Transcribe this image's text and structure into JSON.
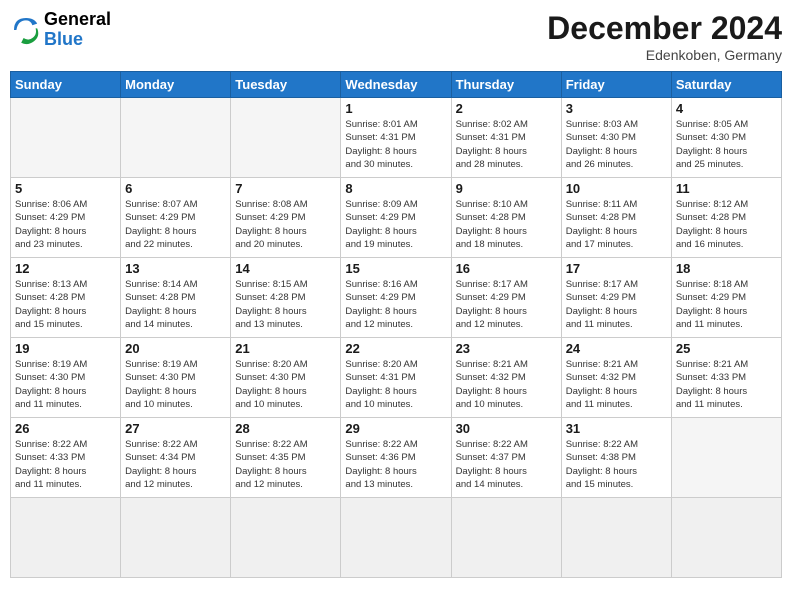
{
  "header": {
    "logo_line1": "General",
    "logo_line2": "Blue",
    "month_title": "December 2024",
    "location": "Edenkoben, Germany"
  },
  "weekdays": [
    "Sunday",
    "Monday",
    "Tuesday",
    "Wednesday",
    "Thursday",
    "Friday",
    "Saturday"
  ],
  "days": [
    {
      "num": "",
      "info": ""
    },
    {
      "num": "",
      "info": ""
    },
    {
      "num": "",
      "info": ""
    },
    {
      "num": "1",
      "info": "Sunrise: 8:01 AM\nSunset: 4:31 PM\nDaylight: 8 hours\nand 30 minutes."
    },
    {
      "num": "2",
      "info": "Sunrise: 8:02 AM\nSunset: 4:31 PM\nDaylight: 8 hours\nand 28 minutes."
    },
    {
      "num": "3",
      "info": "Sunrise: 8:03 AM\nSunset: 4:30 PM\nDaylight: 8 hours\nand 26 minutes."
    },
    {
      "num": "4",
      "info": "Sunrise: 8:05 AM\nSunset: 4:30 PM\nDaylight: 8 hours\nand 25 minutes."
    },
    {
      "num": "5",
      "info": "Sunrise: 8:06 AM\nSunset: 4:29 PM\nDaylight: 8 hours\nand 23 minutes."
    },
    {
      "num": "6",
      "info": "Sunrise: 8:07 AM\nSunset: 4:29 PM\nDaylight: 8 hours\nand 22 minutes."
    },
    {
      "num": "7",
      "info": "Sunrise: 8:08 AM\nSunset: 4:29 PM\nDaylight: 8 hours\nand 20 minutes."
    },
    {
      "num": "8",
      "info": "Sunrise: 8:09 AM\nSunset: 4:29 PM\nDaylight: 8 hours\nand 19 minutes."
    },
    {
      "num": "9",
      "info": "Sunrise: 8:10 AM\nSunset: 4:28 PM\nDaylight: 8 hours\nand 18 minutes."
    },
    {
      "num": "10",
      "info": "Sunrise: 8:11 AM\nSunset: 4:28 PM\nDaylight: 8 hours\nand 17 minutes."
    },
    {
      "num": "11",
      "info": "Sunrise: 8:12 AM\nSunset: 4:28 PM\nDaylight: 8 hours\nand 16 minutes."
    },
    {
      "num": "12",
      "info": "Sunrise: 8:13 AM\nSunset: 4:28 PM\nDaylight: 8 hours\nand 15 minutes."
    },
    {
      "num": "13",
      "info": "Sunrise: 8:14 AM\nSunset: 4:28 PM\nDaylight: 8 hours\nand 14 minutes."
    },
    {
      "num": "14",
      "info": "Sunrise: 8:15 AM\nSunset: 4:28 PM\nDaylight: 8 hours\nand 13 minutes."
    },
    {
      "num": "15",
      "info": "Sunrise: 8:16 AM\nSunset: 4:29 PM\nDaylight: 8 hours\nand 12 minutes."
    },
    {
      "num": "16",
      "info": "Sunrise: 8:17 AM\nSunset: 4:29 PM\nDaylight: 8 hours\nand 12 minutes."
    },
    {
      "num": "17",
      "info": "Sunrise: 8:17 AM\nSunset: 4:29 PM\nDaylight: 8 hours\nand 11 minutes."
    },
    {
      "num": "18",
      "info": "Sunrise: 8:18 AM\nSunset: 4:29 PM\nDaylight: 8 hours\nand 11 minutes."
    },
    {
      "num": "19",
      "info": "Sunrise: 8:19 AM\nSunset: 4:30 PM\nDaylight: 8 hours\nand 11 minutes."
    },
    {
      "num": "20",
      "info": "Sunrise: 8:19 AM\nSunset: 4:30 PM\nDaylight: 8 hours\nand 10 minutes."
    },
    {
      "num": "21",
      "info": "Sunrise: 8:20 AM\nSunset: 4:30 PM\nDaylight: 8 hours\nand 10 minutes."
    },
    {
      "num": "22",
      "info": "Sunrise: 8:20 AM\nSunset: 4:31 PM\nDaylight: 8 hours\nand 10 minutes."
    },
    {
      "num": "23",
      "info": "Sunrise: 8:21 AM\nSunset: 4:32 PM\nDaylight: 8 hours\nand 10 minutes."
    },
    {
      "num": "24",
      "info": "Sunrise: 8:21 AM\nSunset: 4:32 PM\nDaylight: 8 hours\nand 11 minutes."
    },
    {
      "num": "25",
      "info": "Sunrise: 8:21 AM\nSunset: 4:33 PM\nDaylight: 8 hours\nand 11 minutes."
    },
    {
      "num": "26",
      "info": "Sunrise: 8:22 AM\nSunset: 4:33 PM\nDaylight: 8 hours\nand 11 minutes."
    },
    {
      "num": "27",
      "info": "Sunrise: 8:22 AM\nSunset: 4:34 PM\nDaylight: 8 hours\nand 12 minutes."
    },
    {
      "num": "28",
      "info": "Sunrise: 8:22 AM\nSunset: 4:35 PM\nDaylight: 8 hours\nand 12 minutes."
    },
    {
      "num": "29",
      "info": "Sunrise: 8:22 AM\nSunset: 4:36 PM\nDaylight: 8 hours\nand 13 minutes."
    },
    {
      "num": "30",
      "info": "Sunrise: 8:22 AM\nSunset: 4:37 PM\nDaylight: 8 hours\nand 14 minutes."
    },
    {
      "num": "31",
      "info": "Sunrise: 8:22 AM\nSunset: 4:38 PM\nDaylight: 8 hours\nand 15 minutes."
    },
    {
      "num": "",
      "info": ""
    },
    {
      "num": "",
      "info": ""
    },
    {
      "num": "",
      "info": ""
    },
    {
      "num": "",
      "info": ""
    }
  ]
}
